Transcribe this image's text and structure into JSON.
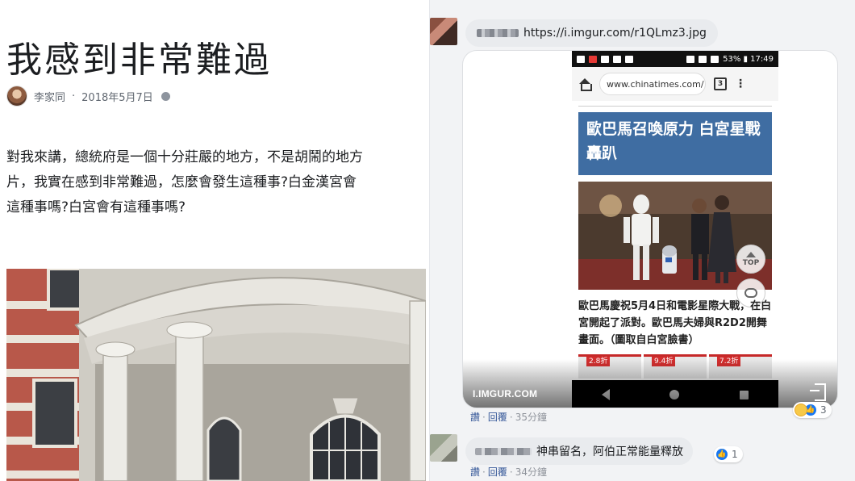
{
  "article": {
    "title": "我感到非常難過",
    "author": "李家同",
    "date": "2018年5月7日",
    "separator": "·",
    "body_lines": [
      "對我來講，總統府是一個十分莊嚴的地方，不是胡鬧的地方",
      "片，我實在感到非常難過，怎麼會發生這種事?白金漢宮會",
      "這種事嗎?白宮會有這種事嗎?"
    ]
  },
  "comment1": {
    "text": "https://i.imgur.com/r1QLmz3.jpg",
    "embed": {
      "source_label": "I.IMGUR.COM",
      "phone": {
        "status_left": "",
        "status_right": "53% ▮ 17:49",
        "url": "www.chinatimes.com/",
        "tabs_count": "3",
        "menu": "⋮",
        "headline": "歐巴馬召喚原力 白宮星戰轟趴",
        "caption": "歐巴馬慶祝5月4日和電影星際大戰，在白宮開起了派對。歐巴馬夫婦與R2D2開舞畫面。（圖取自白宮臉書）",
        "top_label": "TOP",
        "ads": [
          "2.8折",
          "9.4折",
          "7.2折"
        ]
      }
    },
    "actions": {
      "like": "讚",
      "reply": "回覆",
      "time": "35分鐘"
    },
    "reaction_count": "3"
  },
  "comment2": {
    "text": "神串留名，阿伯正常能量釋放",
    "actions": {
      "like": "讚",
      "reply": "回覆",
      "time": "34分鐘"
    },
    "reaction_count": "1"
  },
  "colors": {
    "headline_blue": "#3f6da2",
    "facebook_blue": "#1877f2",
    "link_blue": "#365899",
    "bubble_gray": "#e9ebee"
  }
}
